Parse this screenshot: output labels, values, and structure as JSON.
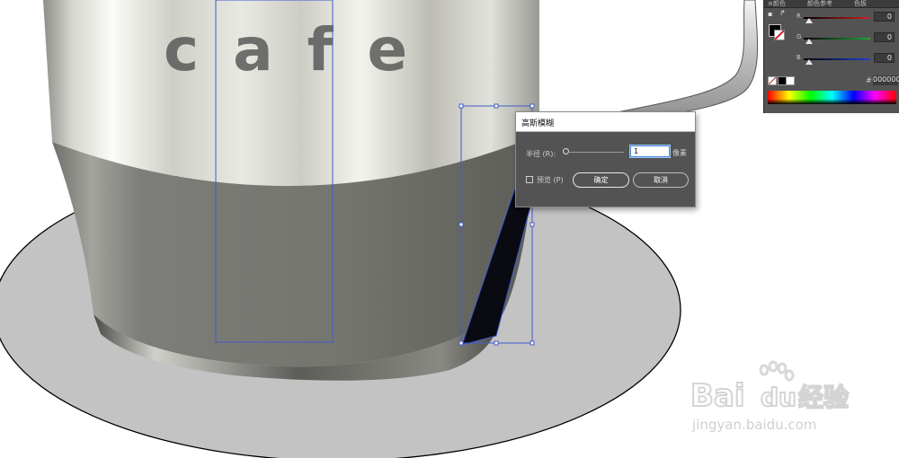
{
  "artwork": {
    "cup_text": "cafe"
  },
  "color_panel": {
    "tabs": [
      "≡颜色",
      "颜色参考",
      "色板"
    ],
    "channels": [
      {
        "label": "R",
        "value": "0",
        "color": "#d21f1f"
      },
      {
        "label": "G",
        "value": "0",
        "color": "#1fa83a"
      },
      {
        "label": "B",
        "value": "0",
        "color": "#1f3fd2"
      }
    ],
    "hex_symbol": "#",
    "hex_value": "000000"
  },
  "gaussian_blur_dialog": {
    "title": "高斯模糊",
    "radius_label": "半径 (R):",
    "radius_value": "1",
    "unit": "像素",
    "preview_label": "预览 (P)",
    "preview_checked": false,
    "ok_label": "确定",
    "cancel_label": "取消"
  },
  "watermark": {
    "brand_left": "Bai",
    "brand_right": "du",
    "brand_suffix": "经验",
    "url": "jingyan.baidu.com"
  },
  "colors": {
    "selection_blue": "#3f5bc8",
    "panel_bg": "#535353"
  }
}
